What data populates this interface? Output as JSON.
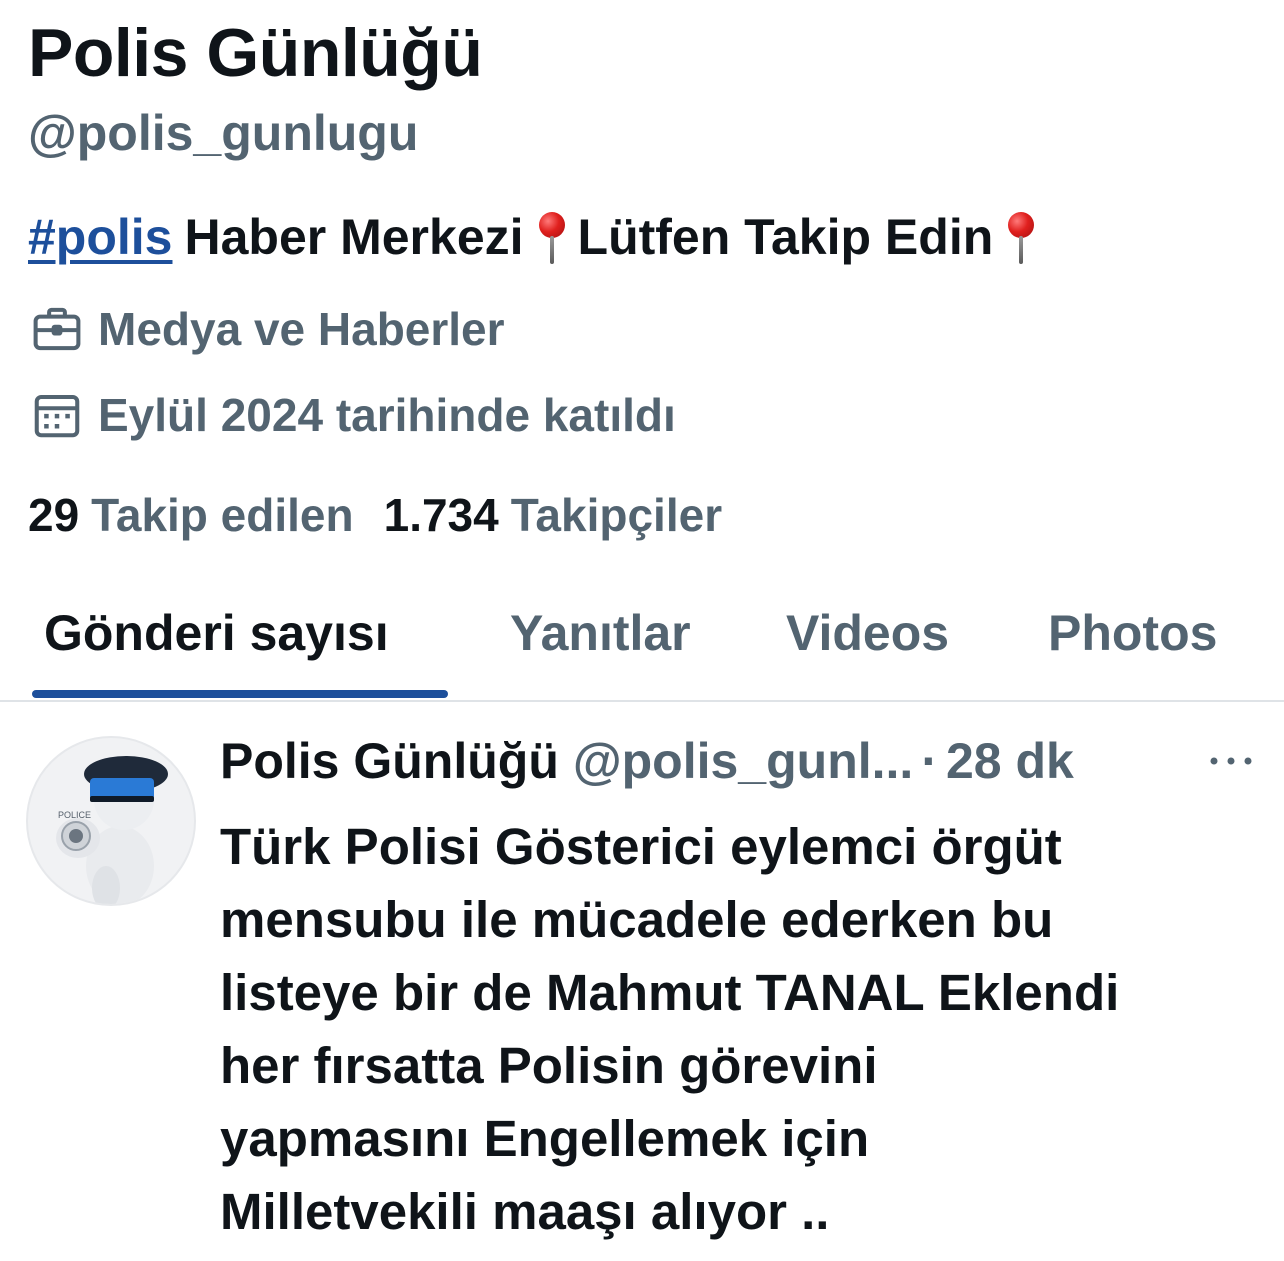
{
  "profile": {
    "display_name": "Polis Günlüğü",
    "handle": "@polis_gunlugu",
    "bio": {
      "hashtag": "#polis",
      "part1": "Haber Merkezi",
      "part2": "Lütfen Takip Edin",
      "emoji": "round-pushpin"
    },
    "category": "Medya ve Haberler",
    "joined": "Eylül 2024 tarihinde katıldı",
    "following_count": "29",
    "following_label": "Takip edilen",
    "followers_count": "1.734",
    "followers_label": "Takipçiler"
  },
  "tabs": [
    {
      "label": "Gönderi sayısı",
      "active": true
    },
    {
      "label": "Yanıtlar",
      "active": false
    },
    {
      "label": "Videos",
      "active": false
    },
    {
      "label": "Photos",
      "active": false
    }
  ],
  "post": {
    "author_name": "Polis Günlüğü",
    "author_handle": "@polis_gunl...",
    "separator": "·",
    "time": "28 dk",
    "text": "Türk Polisi Gösterici eylemci örgüt\nmensubu ile mücadele ederken bu\nlisteye bir de Mahmut TANAL Eklendi\nher fırsatta Polisin görevini\nyapmasını Engellemek için\nMilletvekili maaşı alıyor .."
  },
  "icons": {
    "category": "briefcase-icon",
    "joined": "calendar-icon",
    "more": "more-horizontal-icon"
  },
  "colors": {
    "text_primary": "#0f1419",
    "text_secondary": "#536471",
    "accent": "#1d4f9b",
    "pin": "#e0201e"
  }
}
